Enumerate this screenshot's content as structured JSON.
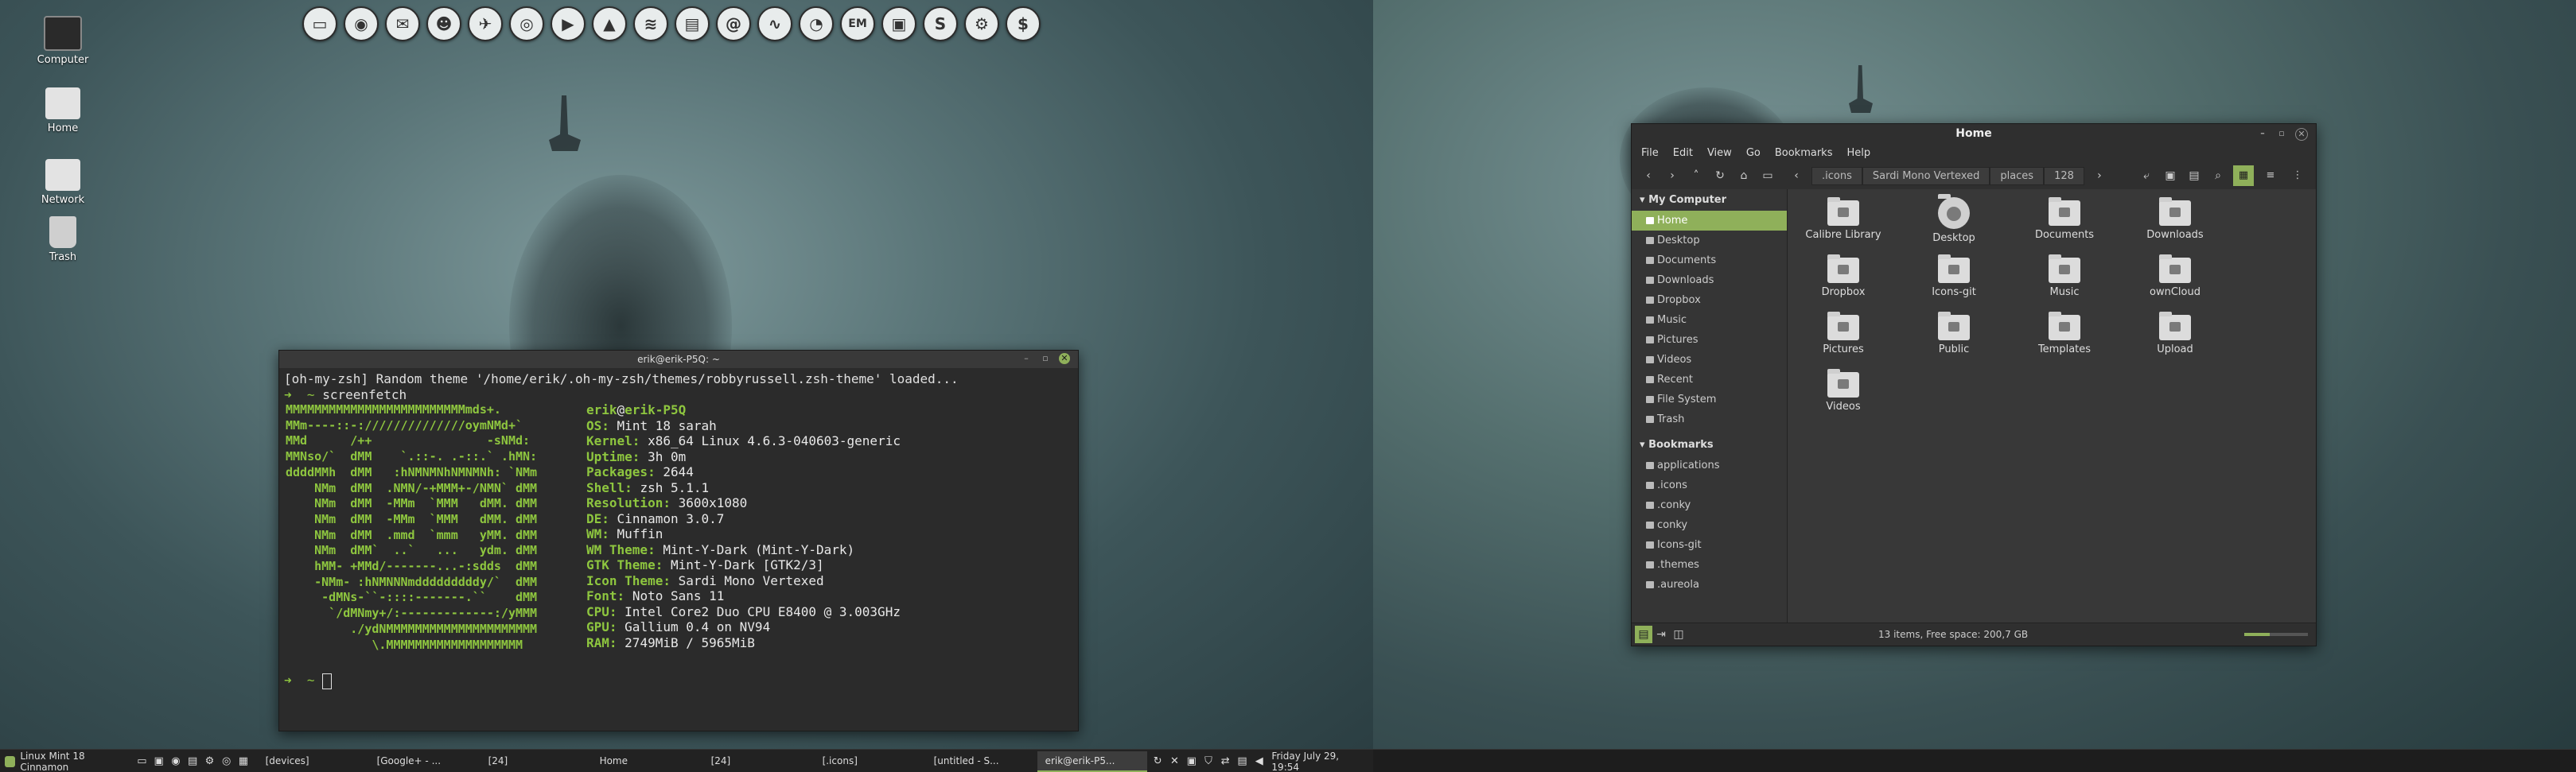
{
  "desktop": {
    "icons": [
      {
        "label": "Computer",
        "icon": "monitor-icon"
      },
      {
        "label": "Home",
        "icon": "home-folder-icon"
      },
      {
        "label": "Network",
        "icon": "network-icon"
      },
      {
        "label": "Trash",
        "icon": "trash-icon"
      }
    ]
  },
  "dock": {
    "icons": [
      "files-icon",
      "firefox-icon",
      "thunderbird-icon",
      "gimp-icon",
      "twitter-icon",
      "chrome-icon",
      "video-icon",
      "vlc-icon",
      "wifi-icon",
      "archive-icon",
      "at-icon",
      "pulse-icon",
      "steam-icon",
      "em-icon",
      "photo-icon",
      "skype-icon",
      "settings-icon",
      "dollar-icon"
    ],
    "glyphs": [
      "▭",
      "◉",
      "✉",
      "☻",
      "✈",
      "◎",
      "▶",
      "▲",
      "≋",
      "▤",
      "@",
      "∿",
      "◔",
      "EM",
      "▣",
      "S",
      "⚙",
      "$"
    ]
  },
  "terminal": {
    "title": "erik@erik-P5Q: ~",
    "line1": "[oh-my-zsh] Random theme '/home/erik/.oh-my-zsh/themes/robbyrussell.zsh-theme' loaded...",
    "prompt_arrow": "➜",
    "prompt_dir": "~",
    "command": "screenfetch",
    "logo": [
      "MMMMMMMMMMMMMMMMMMMMMMMMMmds+.",
      "MMm----::-://////////////oymNMd+`",
      "MMd      /++                -sNMd:",
      "MMNso/`  dMM    `.::-. .-::.` .hMN:",
      "ddddMMh  dMM   :hNMNMNhNMNMNh: `NMm",
      "    NMm  dMM  .NMN/-+MMM+-/NMN` dMM",
      "    NMm  dMM  -MMm  `MMM   dMM. dMM",
      "    NMm  dMM  -MMm  `MMM   dMM. dMM",
      "    NMm  dMM  .mmd  `mmm   yMM. dMM",
      "    NMm  dMM`  ..`   ...   ydm. dMM",
      "    hMM- +MMd/-------...-:sdds  dMM",
      "    -NMm- :hNMNNNmdddddddddy/`  dMM",
      "     -dMNs-``-::::-------.``    dMM",
      "      `/dMNmy+/:-------------:/yMMM",
      "         ./ydNMMMMMMMMMMMMMMMMMMMMM",
      "            \\.MMMMMMMMMMMMMMMMMMM"
    ],
    "user": "erik",
    "host": "erik-P5Q",
    "info": [
      {
        "k": "OS:",
        "v": "Mint 18 sarah"
      },
      {
        "k": "Kernel:",
        "v": "x86_64 Linux 4.6.3-040603-generic"
      },
      {
        "k": "Uptime:",
        "v": "3h 0m"
      },
      {
        "k": "Packages:",
        "v": "2644"
      },
      {
        "k": "Shell:",
        "v": "zsh 5.1.1"
      },
      {
        "k": "Resolution:",
        "v": "3600x1080"
      },
      {
        "k": "DE:",
        "v": "Cinnamon 3.0.7"
      },
      {
        "k": "WM:",
        "v": "Muffin"
      },
      {
        "k": "WM Theme:",
        "v": "Mint-Y-Dark (Mint-Y-Dark)"
      },
      {
        "k": "GTK Theme:",
        "v": "Mint-Y-Dark [GTK2/3]"
      },
      {
        "k": "Icon Theme:",
        "v": "Sardi Mono Vertexed"
      },
      {
        "k": "Font:",
        "v": "Noto Sans 11"
      },
      {
        "k": "CPU:",
        "v": "Intel Core2 Duo CPU E8400 @ 3.003GHz"
      },
      {
        "k": "GPU:",
        "v": "Gallium 0.4 on NV94"
      },
      {
        "k": "RAM:",
        "v": "2749MiB / 5965MiB"
      }
    ]
  },
  "file_manager": {
    "title": "Home",
    "menu": [
      "File",
      "Edit",
      "View",
      "Go",
      "Bookmarks",
      "Help"
    ],
    "breadcrumbs": [
      ".icons",
      "Sardi Mono Vertexed",
      "places",
      "128"
    ],
    "sidebar": {
      "my_computer_label": "My Computer",
      "my_computer": [
        "Home",
        "Desktop",
        "Documents",
        "Downloads",
        "Dropbox",
        "Music",
        "Pictures",
        "Videos",
        "Recent",
        "File System",
        "Trash"
      ],
      "bookmarks_label": "Bookmarks",
      "bookmarks": [
        "applications",
        ".icons",
        ".conky",
        "conky",
        "Icons-git",
        ".themes",
        ".aureola"
      ]
    },
    "files": [
      "Calibre Library",
      "Desktop",
      "Documents",
      "Downloads",
      "Dropbox",
      "Icons-git",
      "Music",
      "ownCloud",
      "Pictures",
      "Public",
      "Templates",
      "Upload",
      "Videos"
    ],
    "status": "13 items, Free space: 200,7 GB",
    "zoom_level": 0.4
  },
  "panel_left": {
    "menu_label": "Linux Mint 18 Cinnamon",
    "tasks": [
      "[devices]",
      "[Google+ - ...",
      "[24]",
      "Home",
      "[24]",
      "[.icons]",
      "[untitled - S...",
      "erik@erik-P5..."
    ],
    "clock": "Friday July 29, 19:54"
  },
  "colors": {
    "accent": "#8fb05a",
    "terminal_green": "#8ec63f"
  }
}
